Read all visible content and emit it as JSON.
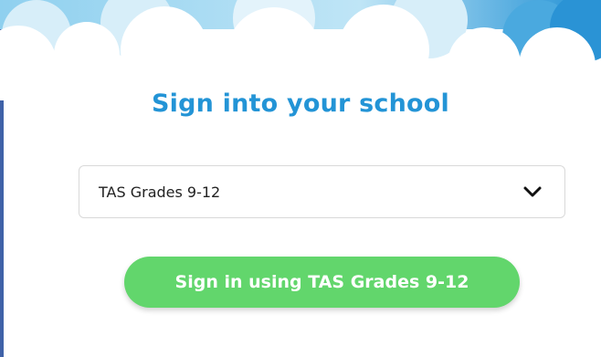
{
  "page": {
    "title": "Sign into your school"
  },
  "school_select": {
    "selected_value": "TAS Grades 9-12",
    "icon": "chevron-down-icon"
  },
  "signin_button": {
    "label": "Sign in using TAS Grades 9-12"
  },
  "colors": {
    "title": "#2394d6",
    "button": "#62d66c",
    "sky_top": "#1f8fd4",
    "cloud": "#ffffff",
    "left_border": "#3f62a8"
  },
  "decor": {
    "background_icon": "clouds-illustration"
  }
}
